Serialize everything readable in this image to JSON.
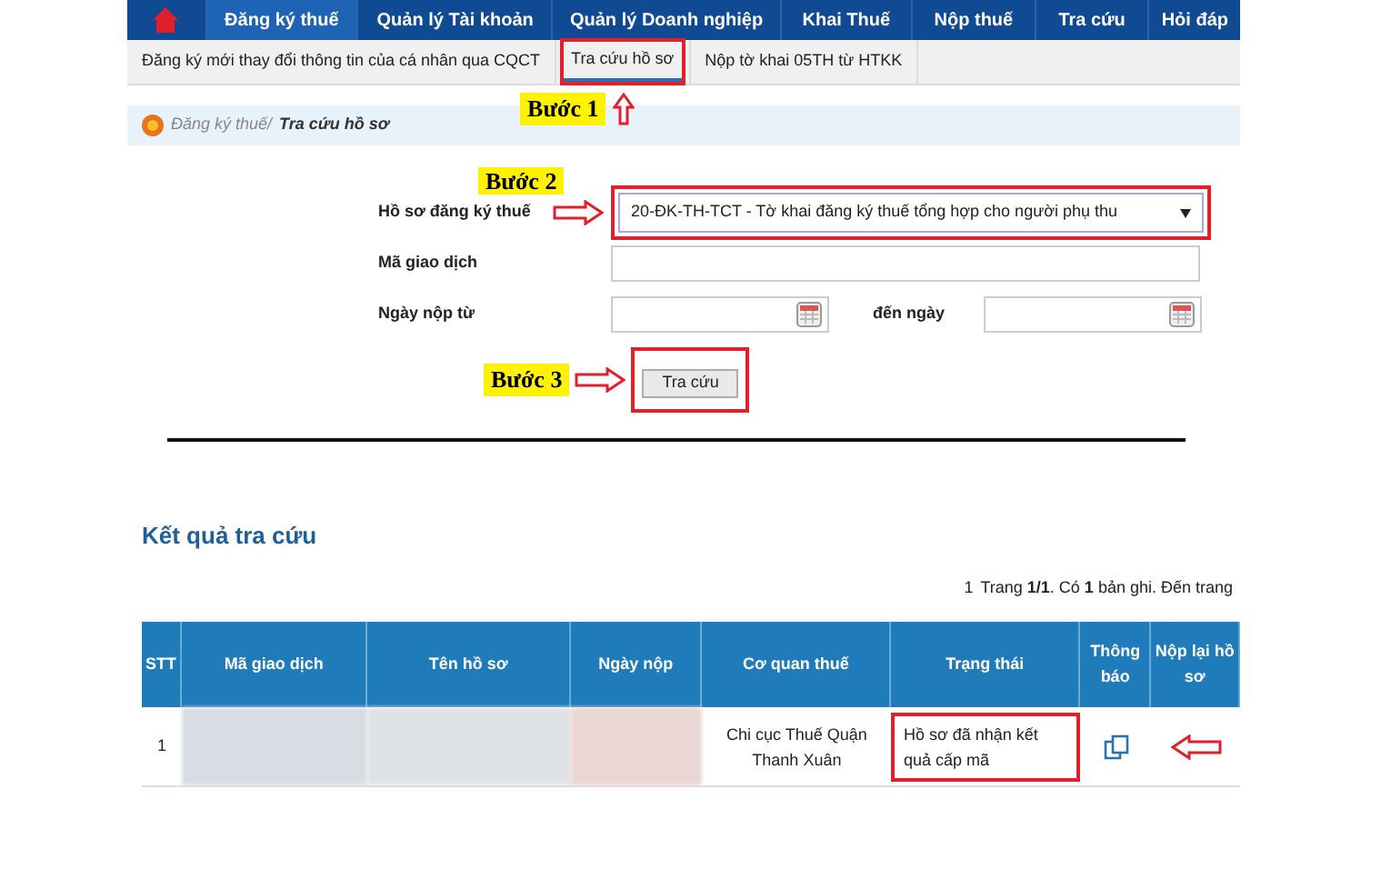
{
  "nav": {
    "items": [
      {
        "label": "Đăng ký thuế",
        "selected": true
      },
      {
        "label": "Quản lý Tài khoản",
        "selected": false
      },
      {
        "label": "Quản lý Doanh nghiệp",
        "selected": false
      },
      {
        "label": "Khai Thuế",
        "selected": false
      },
      {
        "label": "Nộp thuế",
        "selected": false
      },
      {
        "label": "Tra cứu",
        "selected": false
      },
      {
        "label": "Hỏi đáp",
        "selected": false
      }
    ]
  },
  "subnav": {
    "items": [
      {
        "label": "Đăng ký mới thay đổi thông tin của cá nhân qua CQCT",
        "selected": false,
        "highlighted": false
      },
      {
        "label": "Tra cứu hồ sơ",
        "selected": true,
        "highlighted": true
      },
      {
        "label": "Nộp tờ khai 05TH từ HTKK",
        "selected": false,
        "highlighted": false
      }
    ],
    "step": "Bước 1"
  },
  "breadcrumb": {
    "parent": "Đăng ký thuế/",
    "current": "Tra cứu hồ sơ"
  },
  "form": {
    "step": "Bước 2",
    "fields": [
      {
        "kind": "select",
        "label": "Hồ sơ đăng ký thuế",
        "value": "20-ĐK-TH-TCT - Tờ khai đăng ký thuế tổng hợp cho người phụ thu",
        "highlighted": true
      },
      {
        "kind": "text",
        "label": "Mã giao dịch",
        "highlighted": false
      },
      {
        "kind": "daterange",
        "label": "Ngày nộp từ",
        "to_label": "đến ngày",
        "highlighted": false
      }
    ],
    "button": {
      "label": "Tra cứu",
      "highlighted": true,
      "step": "Bước 3"
    }
  },
  "results": {
    "title": "Kết quả tra cứu",
    "page_input": "1",
    "pagination": "Trang **1/1**. Có **1** bản ghi. Đến trang",
    "columns": [
      "STT",
      "Mã giao dịch",
      "Tên hồ sơ",
      "Ngày nộp",
      "Cơ quan thuế",
      "Trạng thái",
      "Thông báo",
      "Nộp lại hồ sơ"
    ],
    "rows": [
      {
        "stt": "1",
        "tax_office": "Chi cục Thuế Quận Thanh Xuân",
        "status": "Hồ sơ đã nhận kết quả cấp mã",
        "status_highlighted": true
      }
    ]
  }
}
